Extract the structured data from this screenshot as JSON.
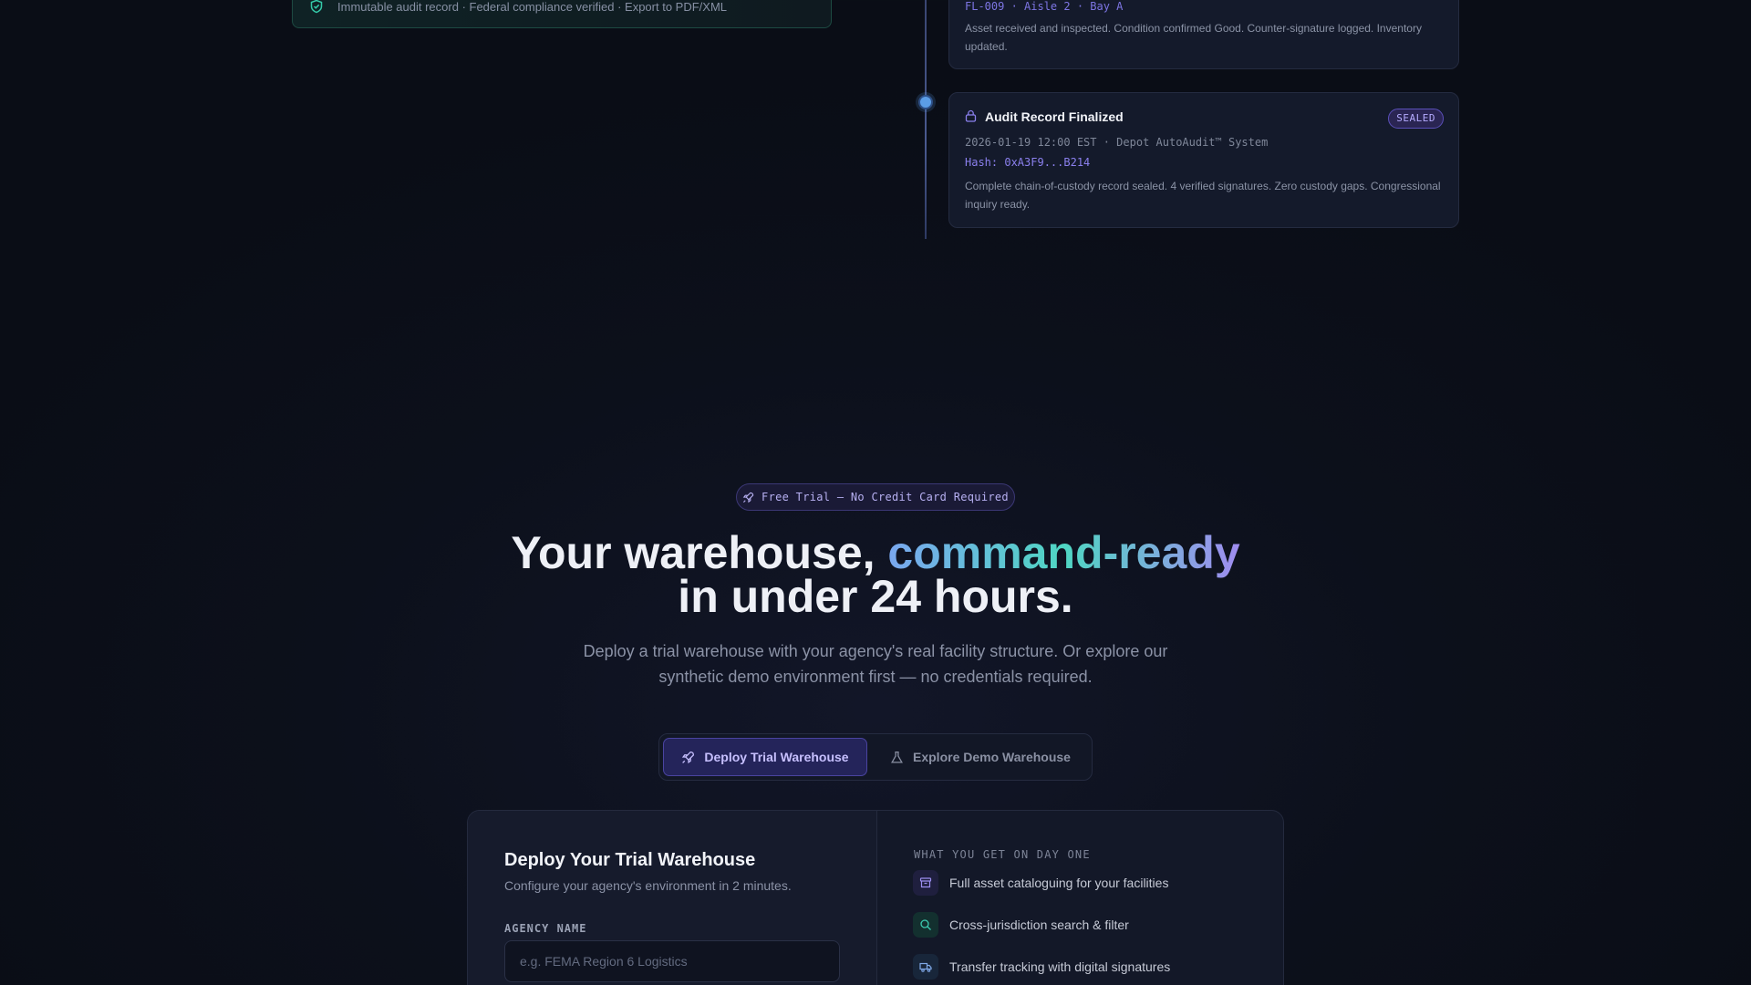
{
  "verified_card": {
    "text": "Immutable audit record · Federal compliance verified · Export to PDF/XML",
    "icon": "shield-check-icon"
  },
  "timeline": {
    "events": [
      {
        "location": "FL-009 · Aisle 2 · Bay A",
        "description": "Asset received and inspected. Condition confirmed Good. Counter-signature logged. Inventory updated."
      },
      {
        "title": "Audit Record Finalized",
        "badge": "SEALED",
        "meta": "2026-01-19 12:00 EST · Depot AutoAudit™ System",
        "hash": "Hash: 0xA3F9...B214",
        "description": "Complete chain-of-custody record sealed. 4 verified signatures. Zero custody gaps. Congressional inquiry ready.",
        "icon": "lock-icon"
      }
    ]
  },
  "hero": {
    "pill": "Free Trial — No Credit Card Required",
    "title_part1": "Your warehouse, ",
    "title_highlight": "command-ready",
    "title_part2": "in under 24 hours.",
    "subtitle": "Deploy a trial warehouse with your agency's real facility structure. Or explore our synthetic demo environment first — no credentials required."
  },
  "toggle": {
    "active_label": "Deploy Trial Warehouse",
    "inactive_label": "Explore Demo Warehouse"
  },
  "deploy_panel": {
    "title": "Deploy Your Trial Warehouse",
    "subtitle": "Configure your agency's environment in 2 minutes.",
    "agency_label": "AGENCY NAME",
    "agency_placeholder": "e.g. FEMA Region 6 Logistics",
    "perks_heading": "WHAT YOU GET ON DAY ONE",
    "perks": [
      {
        "label": "Full asset cataloguing for your facilities",
        "icon": "archive-icon"
      },
      {
        "label": "Cross-jurisdiction search & filter",
        "icon": "search-icon"
      },
      {
        "label": "Transfer tracking with digital signatures",
        "icon": "truck-icon"
      }
    ]
  },
  "colors": {
    "background": "#0c101b",
    "accent_violet": "#7d75e3",
    "accent_teal": "#4fd6c3",
    "timeline_dot": "#5b9de6"
  }
}
